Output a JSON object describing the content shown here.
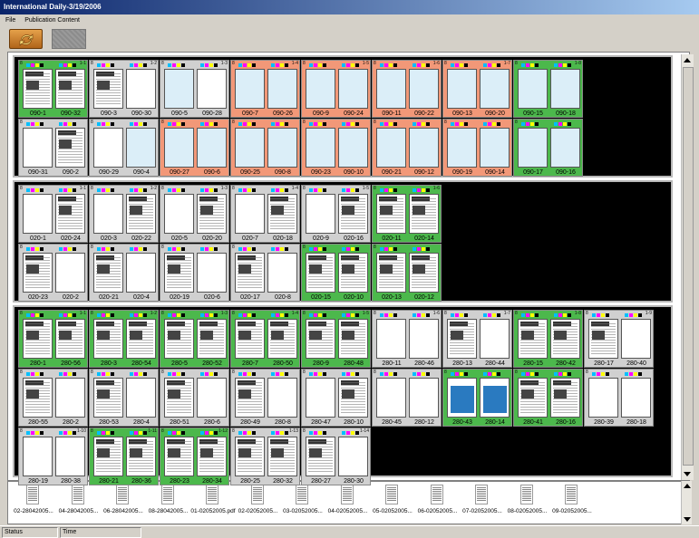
{
  "window": {
    "title": "International Daily-3/19/2006"
  },
  "menu": {
    "items": [
      "File",
      "Publication Content"
    ]
  },
  "statusbar": {
    "status": "Status",
    "time": "Time"
  },
  "marks_colors": [
    "#00bfff",
    "#ff00ff",
    "#ffff00",
    "#000000"
  ],
  "sections": [
    {
      "name": "090",
      "rows": [
        [
          {
            "tag": "8",
            "num": "1-1",
            "color": "green",
            "pages": [
              {
                "label": "090-1",
                "type": "news"
              },
              {
                "label": "090-32",
                "type": "news"
              }
            ]
          },
          {
            "tag": "8",
            "num": "1-2",
            "color": "gray",
            "pages": [
              {
                "label": "090-3",
                "type": "news"
              },
              {
                "label": "090-30",
                "type": "blank"
              }
            ]
          },
          {
            "tag": "8",
            "num": "1-3",
            "color": "gray",
            "pages": [
              {
                "label": "090-5",
                "type": "blue"
              },
              {
                "label": "090-28",
                "type": "blank"
              }
            ]
          },
          {
            "tag": "8",
            "num": "1-4",
            "color": "salmon",
            "pages": [
              {
                "label": "090-7",
                "type": "blue"
              },
              {
                "label": "090-26",
                "type": "blue"
              }
            ]
          },
          {
            "tag": "8",
            "num": "1-5",
            "color": "salmon",
            "pages": [
              {
                "label": "090-9",
                "type": "blue"
              },
              {
                "label": "090-24",
                "type": "blue"
              }
            ]
          },
          {
            "tag": "8",
            "num": "1-6",
            "color": "salmon",
            "pages": [
              {
                "label": "090-11",
                "type": "blue"
              },
              {
                "label": "090-22",
                "type": "blue"
              }
            ]
          },
          {
            "tag": "8",
            "num": "1-7",
            "color": "salmon",
            "pages": [
              {
                "label": "090-13",
                "type": "blue"
              },
              {
                "label": "090-20",
                "type": "blue"
              }
            ]
          },
          {
            "tag": "8",
            "num": "1-8",
            "color": "green",
            "pages": [
              {
                "label": "090-15",
                "type": "blue"
              },
              {
                "label": "090-18",
                "type": "blue"
              }
            ]
          }
        ],
        [
          {
            "tag": "8",
            "num": "",
            "color": "gray",
            "pages": [
              {
                "label": "090-31",
                "type": "blank"
              },
              {
                "label": "090-2",
                "type": "news"
              }
            ]
          },
          {
            "tag": "8",
            "num": "",
            "color": "gray",
            "pages": [
              {
                "label": "090-29",
                "type": "blank"
              },
              {
                "label": "090-4",
                "type": "blue"
              }
            ]
          },
          {
            "tag": "8",
            "num": "",
            "color": "salmon",
            "pages": [
              {
                "label": "090-27",
                "type": "blue"
              },
              {
                "label": "090-6",
                "type": "blue"
              }
            ]
          },
          {
            "tag": "8",
            "num": "",
            "color": "salmon",
            "pages": [
              {
                "label": "090-25",
                "type": "blue"
              },
              {
                "label": "090-8",
                "type": "blue"
              }
            ]
          },
          {
            "tag": "8",
            "num": "",
            "color": "salmon",
            "pages": [
              {
                "label": "090-23",
                "type": "blue"
              },
              {
                "label": "090-10",
                "type": "blue"
              }
            ]
          },
          {
            "tag": "8",
            "num": "",
            "color": "salmon",
            "pages": [
              {
                "label": "090-21",
                "type": "blue"
              },
              {
                "label": "090-12",
                "type": "blue"
              }
            ]
          },
          {
            "tag": "8",
            "num": "",
            "color": "salmon",
            "pages": [
              {
                "label": "090-19",
                "type": "blue"
              },
              {
                "label": "090-14",
                "type": "blue"
              }
            ]
          },
          {
            "tag": "8",
            "num": "",
            "color": "green",
            "pages": [
              {
                "label": "090-17",
                "type": "blue"
              },
              {
                "label": "090-16",
                "type": "blue"
              }
            ]
          }
        ]
      ]
    },
    {
      "name": "020",
      "rows": [
        [
          {
            "tag": "8",
            "num": "1-1",
            "color": "gray",
            "pages": [
              {
                "label": "020-1",
                "type": "blank"
              },
              {
                "label": "020-24",
                "type": "news"
              }
            ]
          },
          {
            "tag": "8",
            "num": "1-2",
            "color": "gray",
            "pages": [
              {
                "label": "020-3",
                "type": "blank"
              },
              {
                "label": "020-22",
                "type": "news"
              }
            ]
          },
          {
            "tag": "8",
            "num": "1-3",
            "color": "gray",
            "pages": [
              {
                "label": "020-5",
                "type": "blank"
              },
              {
                "label": "020-20",
                "type": "news"
              }
            ]
          },
          {
            "tag": "8",
            "num": "1-4",
            "color": "gray",
            "pages": [
              {
                "label": "020-7",
                "type": "blank"
              },
              {
                "label": "020-18",
                "type": "news"
              }
            ]
          },
          {
            "tag": "8",
            "num": "1-5",
            "color": "gray",
            "pages": [
              {
                "label": "020-9",
                "type": "blank"
              },
              {
                "label": "020-16",
                "type": "news"
              }
            ]
          },
          {
            "tag": "8",
            "num": "1-6",
            "color": "green",
            "pages": [
              {
                "label": "020-11",
                "type": "news"
              },
              {
                "label": "020-14",
                "type": "news"
              }
            ]
          }
        ],
        [
          {
            "tag": "8",
            "num": "",
            "color": "gray",
            "pages": [
              {
                "label": "020-23",
                "type": "news"
              },
              {
                "label": "020-2",
                "type": "blank"
              }
            ]
          },
          {
            "tag": "8",
            "num": "",
            "color": "gray",
            "pages": [
              {
                "label": "020-21",
                "type": "news"
              },
              {
                "label": "020-4",
                "type": "blank"
              }
            ]
          },
          {
            "tag": "8",
            "num": "",
            "color": "gray",
            "pages": [
              {
                "label": "020-19",
                "type": "news"
              },
              {
                "label": "020-6",
                "type": "blank"
              }
            ]
          },
          {
            "tag": "8",
            "num": "",
            "color": "gray",
            "pages": [
              {
                "label": "020-17",
                "type": "news"
              },
              {
                "label": "020-8",
                "type": "blank"
              }
            ]
          },
          {
            "tag": "8",
            "num": "",
            "color": "green",
            "pages": [
              {
                "label": "020-15",
                "type": "news"
              },
              {
                "label": "020-10",
                "type": "news"
              }
            ]
          },
          {
            "tag": "8",
            "num": "",
            "color": "green",
            "pages": [
              {
                "label": "020-13",
                "type": "news"
              },
              {
                "label": "020-12",
                "type": "news"
              }
            ]
          }
        ]
      ]
    },
    {
      "name": "280",
      "rows": [
        [
          {
            "tag": "8",
            "num": "1-1",
            "color": "green",
            "pages": [
              {
                "label": "280-1",
                "type": "news"
              },
              {
                "label": "280-56",
                "type": "news"
              }
            ]
          },
          {
            "tag": "8",
            "num": "1-2",
            "color": "green",
            "pages": [
              {
                "label": "280-3",
                "type": "news"
              },
              {
                "label": "280-54",
                "type": "news"
              }
            ]
          },
          {
            "tag": "8",
            "num": "1-3",
            "color": "green",
            "pages": [
              {
                "label": "280-5",
                "type": "news"
              },
              {
                "label": "280-52",
                "type": "news"
              }
            ]
          },
          {
            "tag": "8",
            "num": "1-4",
            "color": "green",
            "pages": [
              {
                "label": "280-7",
                "type": "news"
              },
              {
                "label": "280-50",
                "type": "news"
              }
            ]
          },
          {
            "tag": "8",
            "num": "1-5",
            "color": "green",
            "pages": [
              {
                "label": "280-9",
                "type": "news"
              },
              {
                "label": "280-48",
                "type": "news"
              }
            ]
          },
          {
            "tag": "8",
            "num": "1-6",
            "color": "gray",
            "pages": [
              {
                "label": "280-11",
                "type": "blank"
              },
              {
                "label": "280-46",
                "type": "blank"
              }
            ]
          },
          {
            "tag": "8",
            "num": "1-7",
            "color": "gray",
            "pages": [
              {
                "label": "280-13",
                "type": "news"
              },
              {
                "label": "280-44",
                "type": "blank"
              }
            ]
          },
          {
            "tag": "8",
            "num": "1-8",
            "color": "green",
            "pages": [
              {
                "label": "280-15",
                "type": "news"
              },
              {
                "label": "280-42",
                "type": "news"
              }
            ]
          },
          {
            "tag": "8",
            "num": "1-9",
            "color": "gray",
            "pages": [
              {
                "label": "280-17",
                "type": "news"
              },
              {
                "label": "280-40",
                "type": "blank"
              }
            ]
          }
        ],
        [
          {
            "tag": "8",
            "num": "",
            "color": "gray",
            "pages": [
              {
                "label": "280-55",
                "type": "news"
              },
              {
                "label": "280-2",
                "type": "blank"
              }
            ]
          },
          {
            "tag": "8",
            "num": "",
            "color": "gray",
            "pages": [
              {
                "label": "280-53",
                "type": "news"
              },
              {
                "label": "280-4",
                "type": "blank"
              }
            ]
          },
          {
            "tag": "8",
            "num": "",
            "color": "gray",
            "pages": [
              {
                "label": "280-51",
                "type": "news"
              },
              {
                "label": "280-6",
                "type": "blank"
              }
            ]
          },
          {
            "tag": "8",
            "num": "",
            "color": "gray",
            "pages": [
              {
                "label": "280-49",
                "type": "news"
              },
              {
                "label": "280-8",
                "type": "blank"
              }
            ]
          },
          {
            "tag": "8",
            "num": "",
            "color": "gray",
            "pages": [
              {
                "label": "280-47",
                "type": "blank"
              },
              {
                "label": "280-10",
                "type": "news"
              }
            ]
          },
          {
            "tag": "8",
            "num": "",
            "color": "gray",
            "pages": [
              {
                "label": "280-45",
                "type": "blank"
              },
              {
                "label": "280-12",
                "type": "blank"
              }
            ]
          },
          {
            "tag": "8",
            "num": "",
            "color": "green",
            "pages": [
              {
                "label": "280-43",
                "type": "ad"
              },
              {
                "label": "280-14",
                "type": "ad"
              }
            ]
          },
          {
            "tag": "8",
            "num": "",
            "color": "green",
            "pages": [
              {
                "label": "280-41",
                "type": "news"
              },
              {
                "label": "280-16",
                "type": "news"
              }
            ]
          },
          {
            "tag": "8",
            "num": "",
            "color": "gray",
            "pages": [
              {
                "label": "280-39",
                "type": "blank"
              },
              {
                "label": "280-18",
                "type": "blank"
              }
            ]
          }
        ],
        [
          {
            "tag": "8",
            "num": "1-10",
            "color": "gray",
            "pages": [
              {
                "label": "280-19",
                "type": "blank"
              },
              {
                "label": "280-38",
                "type": "blank"
              }
            ]
          },
          {
            "tag": "8",
            "num": "1-11",
            "color": "green",
            "pages": [
              {
                "label": "280-21",
                "type": "news"
              },
              {
                "label": "280-36",
                "type": "news"
              }
            ]
          },
          {
            "tag": "8",
            "num": "1-12",
            "color": "green",
            "pages": [
              {
                "label": "280-23",
                "type": "news"
              },
              {
                "label": "280-34",
                "type": "news"
              }
            ]
          },
          {
            "tag": "8",
            "num": "1-13",
            "color": "gray",
            "pages": [
              {
                "label": "280-25",
                "type": "news"
              },
              {
                "label": "280-32",
                "type": "news"
              }
            ]
          },
          {
            "tag": "8",
            "num": "1-14",
            "color": "gray",
            "pages": [
              {
                "label": "280-27",
                "type": "news"
              },
              {
                "label": "280-30",
                "type": "blank"
              }
            ]
          }
        ]
      ]
    }
  ],
  "thumbnails": [
    "02-28042005...",
    "04-28042005...",
    "06-28042005...",
    "08-28042005...",
    "01-02052005.pdf",
    "02-02052005...",
    "03-02052005...",
    "04-02052005...",
    "05-02052005...",
    "06-02052005...",
    "07-02052005...",
    "08-02052005...",
    "09-02052005..."
  ]
}
